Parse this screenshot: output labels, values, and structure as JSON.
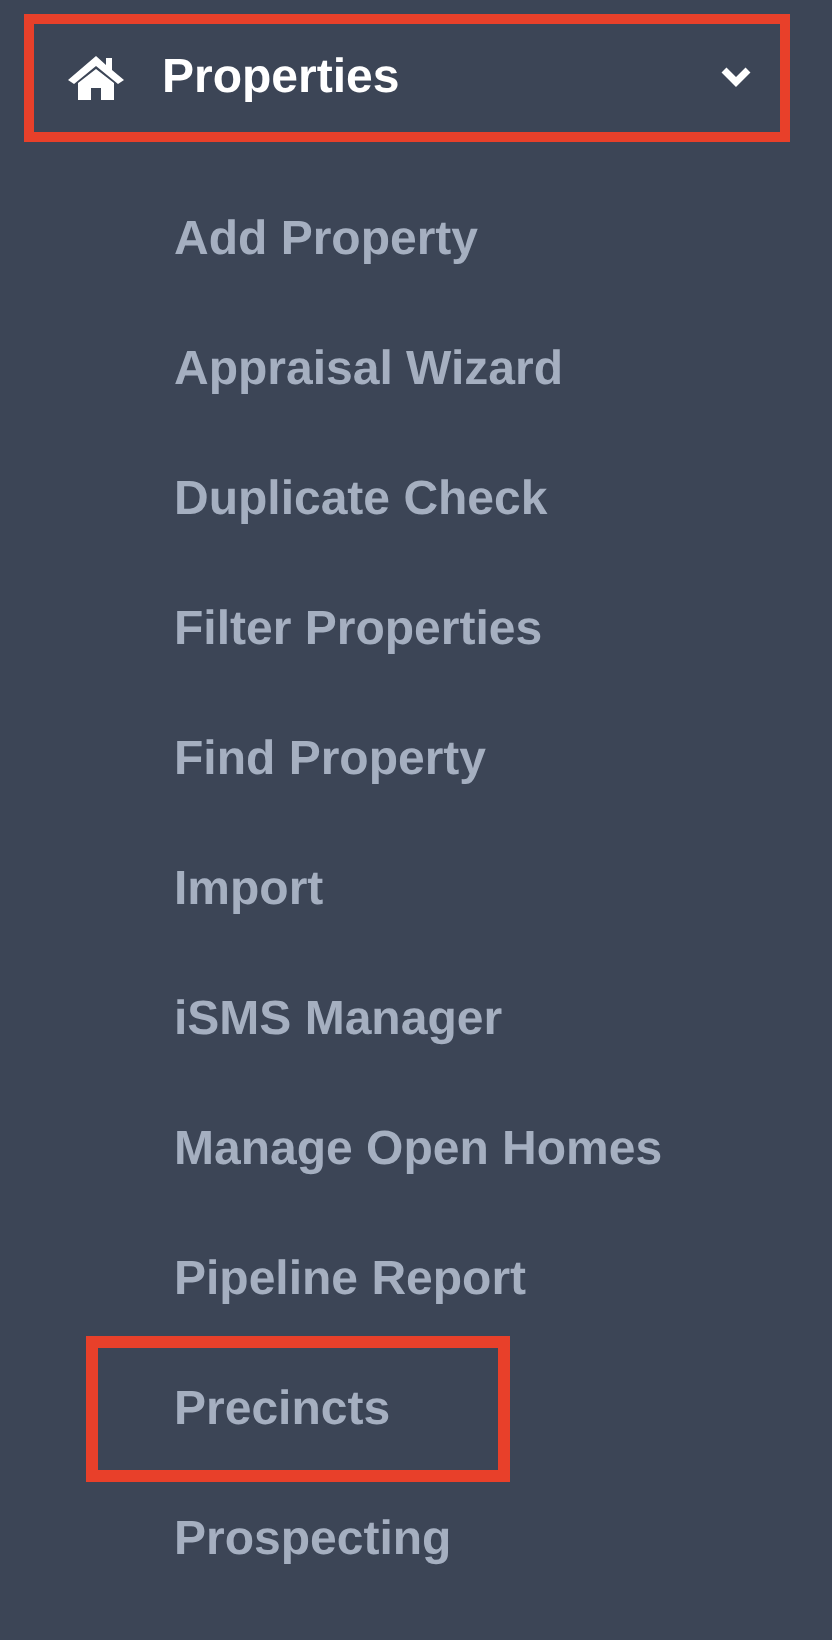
{
  "menu": {
    "title": "Properties",
    "expanded": true,
    "highlighted": true,
    "items": [
      {
        "label": "Add Property",
        "highlighted": false
      },
      {
        "label": "Appraisal Wizard",
        "highlighted": false
      },
      {
        "label": "Duplicate Check",
        "highlighted": false
      },
      {
        "label": "Filter Properties",
        "highlighted": false
      },
      {
        "label": "Find Property",
        "highlighted": false
      },
      {
        "label": "Import",
        "highlighted": false
      },
      {
        "label": "iSMS Manager",
        "highlighted": false
      },
      {
        "label": "Manage Open Homes",
        "highlighted": false
      },
      {
        "label": "Pipeline Report",
        "highlighted": false
      },
      {
        "label": "Precincts",
        "highlighted": true
      },
      {
        "label": "Prospecting",
        "highlighted": false
      }
    ]
  }
}
